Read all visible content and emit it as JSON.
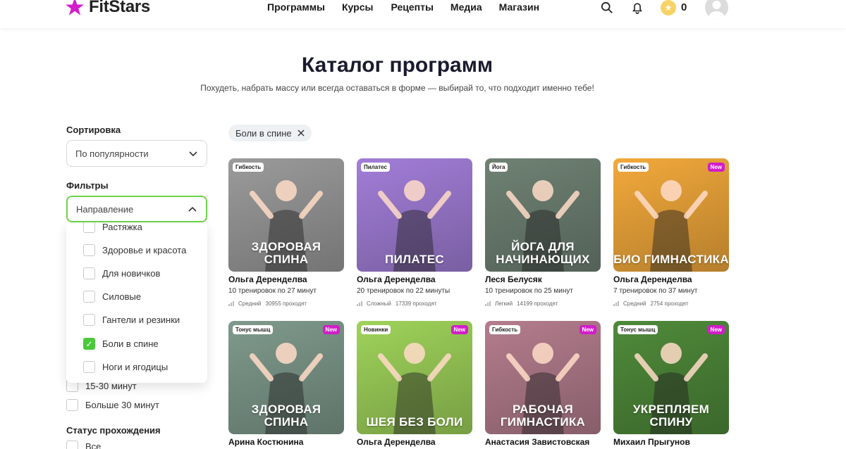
{
  "header": {
    "logo": "FitStars",
    "nav": [
      "Программы",
      "Курсы",
      "Рецепты",
      "Медиа",
      "Магазин"
    ],
    "coins": "0",
    "icons": [
      "search-icon",
      "bell-icon",
      "star-coin-icon",
      "avatar"
    ]
  },
  "catalog": {
    "title": "Каталог программ",
    "subtitle": "Похудеть, набрать массу или всегда оставаться в форме — выбирай то, что подходит именно тебе!"
  },
  "sidebar": {
    "sort_label": "Сортировка",
    "sort_value": "По популярности",
    "filters_label": "Фильтры",
    "direction_value": "Направление",
    "direction_options": [
      {
        "label": "Растяжка",
        "checked": false
      },
      {
        "label": "Здоровье и красота",
        "checked": false
      },
      {
        "label": "Для новичков",
        "checked": false
      },
      {
        "label": "Силовые",
        "checked": false
      },
      {
        "label": "Гантели и резинки",
        "checked": false
      },
      {
        "label": "Боли в спине",
        "checked": true
      },
      {
        "label": "Ноги и ягодицы",
        "checked": false
      }
    ],
    "duration_options": [
      "15-30 минут",
      "Больше 30 минут"
    ],
    "status_label": "Статус прохождения",
    "status_options": [
      "Все"
    ]
  },
  "active_filter": "Боли в спине",
  "colors": {
    "accent_green": "#4bc93a",
    "brand_magenta": "#d21dc9"
  },
  "cards": [
    {
      "tag": "Гибкость",
      "new": "",
      "overlay": "ЗДОРОВАЯ СПИНА",
      "coach": "Ольга Деренделва",
      "meta": "10 тренировок по 27 минут",
      "level": "Средний",
      "count": "30955 проходят",
      "bg": "#9b9b9b"
    },
    {
      "tag": "Пилатес",
      "new": "",
      "overlay": "ПИЛАТЕС",
      "coach": "Ольга Деренделва",
      "meta": "20 тренировок по 22 минуты",
      "level": "Сложный",
      "count": "17339 проходят",
      "bg": "#a27ed8"
    },
    {
      "tag": "Йога",
      "new": "",
      "overlay": "ЙОГА ДЛЯ НАЧИНАЮЩИХ",
      "coach": "Леся Белусяк",
      "meta": "10 тренировок по 25 минут",
      "level": "Легкий",
      "count": "14199 проходят",
      "bg": "#6f8274"
    },
    {
      "tag": "Гибкость",
      "new": "New",
      "overlay": "БИО ГИМНАСТИКА",
      "coach": "Ольга Деренделва",
      "meta": "7 тренировок по 37 минут",
      "level": "Средний",
      "count": "2754 проходят",
      "bg": "#f2a93b"
    },
    {
      "tag": "Тонус мышц",
      "new": "New",
      "overlay": "ЗДОРОВАЯ СПИНА",
      "coach": "Арина Костюнина",
      "bg": "#7f9a8c"
    },
    {
      "tag": "Новинки",
      "new": "New",
      "overlay": "ШЕЯ БЕЗ БОЛИ",
      "coach": "Ольга Деренделва",
      "bg": "#9fd35a"
    },
    {
      "tag": "Гибкость",
      "new": "New",
      "overlay": "РАБОЧАЯ ГИМНАСТИКА",
      "coach": "Анастасия Завистовская",
      "bg": "#b47d8e"
    },
    {
      "tag": "Тонус мышц",
      "new": "New",
      "overlay": "УКРЕПЛЯЕМ СПИНУ",
      "coach": "Михаил Прыгунов",
      "bg": "#4f8a3a"
    }
  ]
}
